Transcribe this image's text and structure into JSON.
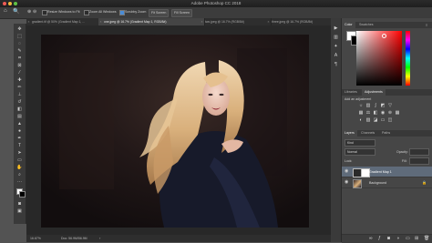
{
  "app": {
    "title": "Adobe Photoshop CC 2018"
  },
  "options_bar": {
    "resize_windows_label": "Resize Windows to Fit",
    "zoom_all_windows_label": "Zoom All Windows",
    "scrubby_zoom_label": "Scrubby Zoom",
    "fit_screen_label": "Fit Screen",
    "fill_screen_label": "Fill Screen"
  },
  "document_tabs": [
    {
      "label": "gradient.tif @ 50% (Gradient Map 1, ...",
      "active": false
    },
    {
      "label": "one.jpeg @ 16.7% (Gradient Map 1, RGB/8#)",
      "active": true
    },
    {
      "label": "two.jpeg @ 16.7% (RGB/8#)",
      "active": false
    },
    {
      "label": "three.jpeg @ 16.7% (RGB/8#)",
      "active": false
    }
  ],
  "status_bar": {
    "zoom": "16.67%",
    "doc_info": "Doc: 56.9M/56.9M"
  },
  "color_panel": {
    "tabs": [
      "Color",
      "Swatches"
    ],
    "active_tab": "Color",
    "hue_color": "#ff0000"
  },
  "adjustments_panel": {
    "tabs": [
      "Libraries",
      "Adjustments"
    ],
    "active_tab": "Adjustments",
    "add_label": "Add an adjustment"
  },
  "layers_panel": {
    "tabs": [
      "Layers",
      "Channels",
      "Paths"
    ],
    "active_tab": "Layers",
    "kind_filter": "Kind",
    "blend_mode": "Normal",
    "opacity_label": "Opacity:",
    "fill_label": "Fill:",
    "lock_label": "Lock:",
    "layers": [
      {
        "name": "Gradient Map 1",
        "selected": true
      },
      {
        "name": "Background",
        "selected": false
      }
    ]
  }
}
